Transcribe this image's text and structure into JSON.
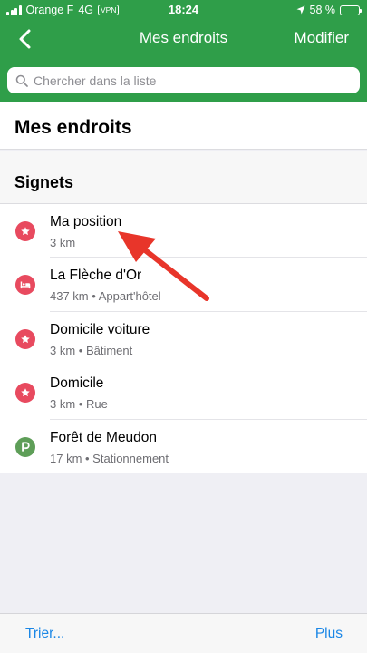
{
  "status_bar": {
    "carrier": "Orange F",
    "network": "4G",
    "vpn": "VPN",
    "time": "18:24",
    "battery_percent": "58 %",
    "battery_level": 0.58
  },
  "nav": {
    "title": "Mes endroits",
    "right_label": "Modifier",
    "back_icon": "chevron-left-icon"
  },
  "search": {
    "placeholder": "Chercher dans la liste"
  },
  "page": {
    "title": "Mes endroits"
  },
  "section": {
    "title": "Signets"
  },
  "bookmarks": [
    {
      "name": "Ma position",
      "meta": "3 km",
      "icon": "star-icon",
      "color": "#e84a5f"
    },
    {
      "name": "La Flèche d'Or",
      "meta": "437 km • Appart'hôtel",
      "icon": "hotel-icon",
      "color": "#e84a5f"
    },
    {
      "name": "Domicile voiture",
      "meta": "3 km • Bâtiment",
      "icon": "star-icon",
      "color": "#e84a5f"
    },
    {
      "name": "Domicile",
      "meta": "3 km • Rue",
      "icon": "star-icon",
      "color": "#e84a5f"
    },
    {
      "name": "Forêt de Meudon",
      "meta": "17 km • Stationnement",
      "icon": "parking-icon",
      "color": "#5e9e58"
    }
  ],
  "toolbar": {
    "left_label": "Trier...",
    "right_label": "Plus"
  },
  "colors": {
    "header_green": "#2f9e49",
    "accent_blue": "#1b87e6",
    "annotation_red": "#e8352a"
  }
}
